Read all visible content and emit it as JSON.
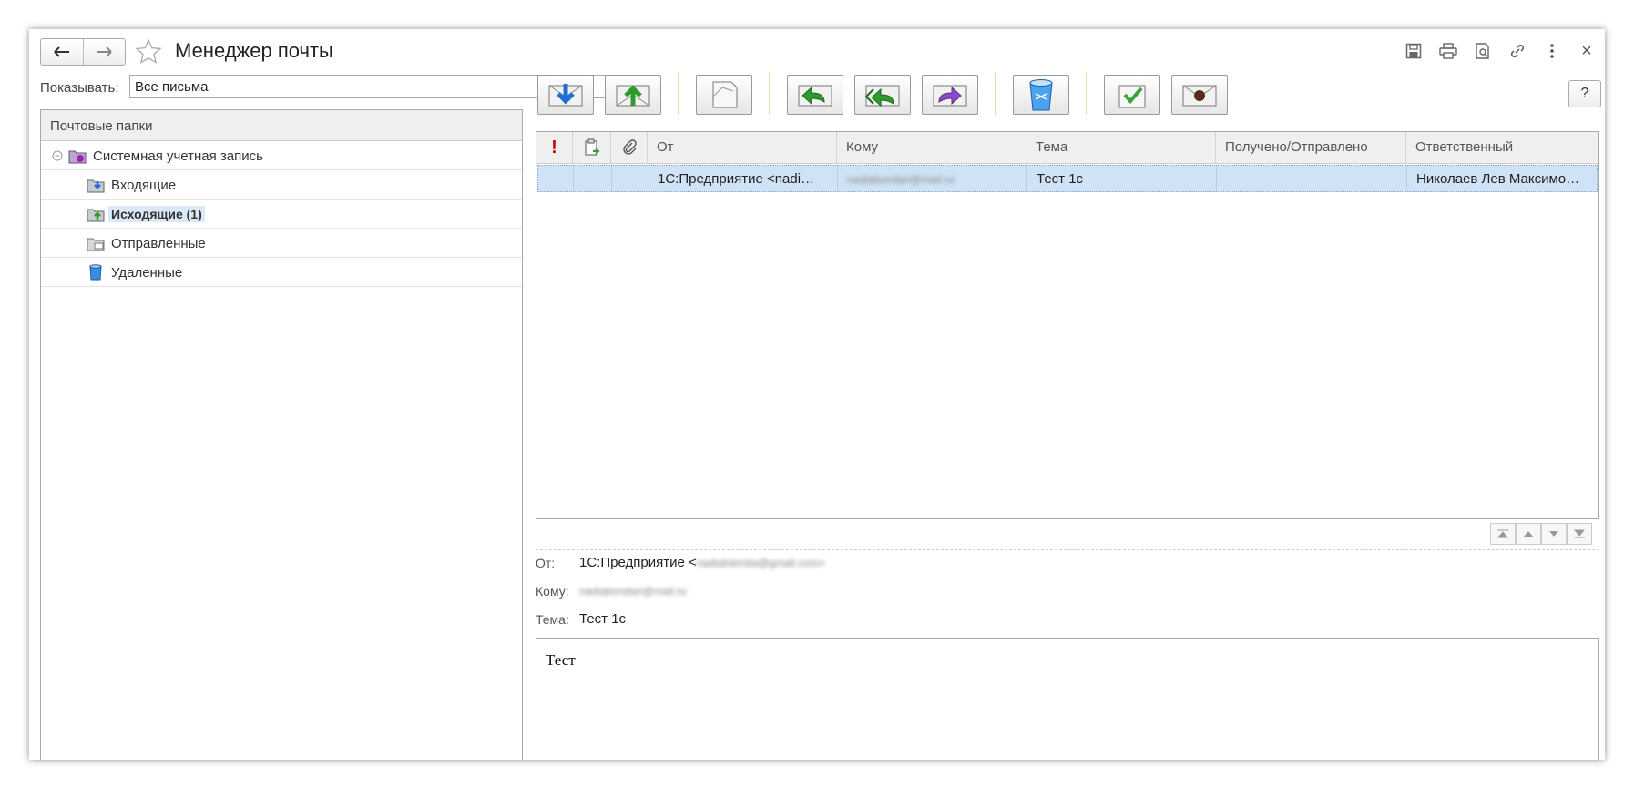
{
  "window": {
    "title": "Менеджер почты",
    "tools": [
      "save-icon",
      "print-icon",
      "preview-icon",
      "link-icon",
      "more-icon",
      "close-icon"
    ],
    "close_label": "×"
  },
  "filter": {
    "label": "Показывать:",
    "value": "Все письма"
  },
  "folders": {
    "header": "Почтовые папки",
    "account": "Системная учетная запись",
    "items": [
      {
        "label": "Входящие",
        "icon": "inbox-folder-icon",
        "selected": false
      },
      {
        "label": "Исходящие (1)",
        "icon": "outbox-folder-icon",
        "selected": true
      },
      {
        "label": "Отправленные",
        "icon": "sent-folder-icon",
        "selected": false
      },
      {
        "label": "Удаленные",
        "icon": "trash-folder-icon",
        "selected": false
      }
    ]
  },
  "toolbar": {
    "buttons": [
      "receive-icon",
      "send-icon",
      "new-message-icon",
      "reply-icon",
      "reply-all-icon",
      "forward-icon",
      "delete-icon",
      "mark-processed-icon",
      "mark-unread-icon"
    ],
    "help_label": "?"
  },
  "table": {
    "columns": [
      "!",
      "",
      "",
      "От",
      "Кому",
      "Тема",
      "Получено/Отправлено",
      "Ответственный"
    ],
    "rows": [
      {
        "from": "1С:Предприятие <nadi…",
        "to": "nadiabondari@mail.ru",
        "subject": "Тест 1с",
        "date": "",
        "owner": "Николаев Лев Максимо…"
      }
    ]
  },
  "preview": {
    "from_label": "От:",
    "from_value": "1С:Предприятие <",
    "from_email": "nadiatokmila@gmail.com>",
    "to_label": "Кому:",
    "to_value": "nadiabondari@mail.ru",
    "subject_label": "Тема:",
    "subject_value": "Тест 1с",
    "body": "Тест"
  },
  "colors": {
    "selection": "#cfe2f6",
    "accent_red": "#cc0000",
    "separator": "#e8d9a8"
  }
}
